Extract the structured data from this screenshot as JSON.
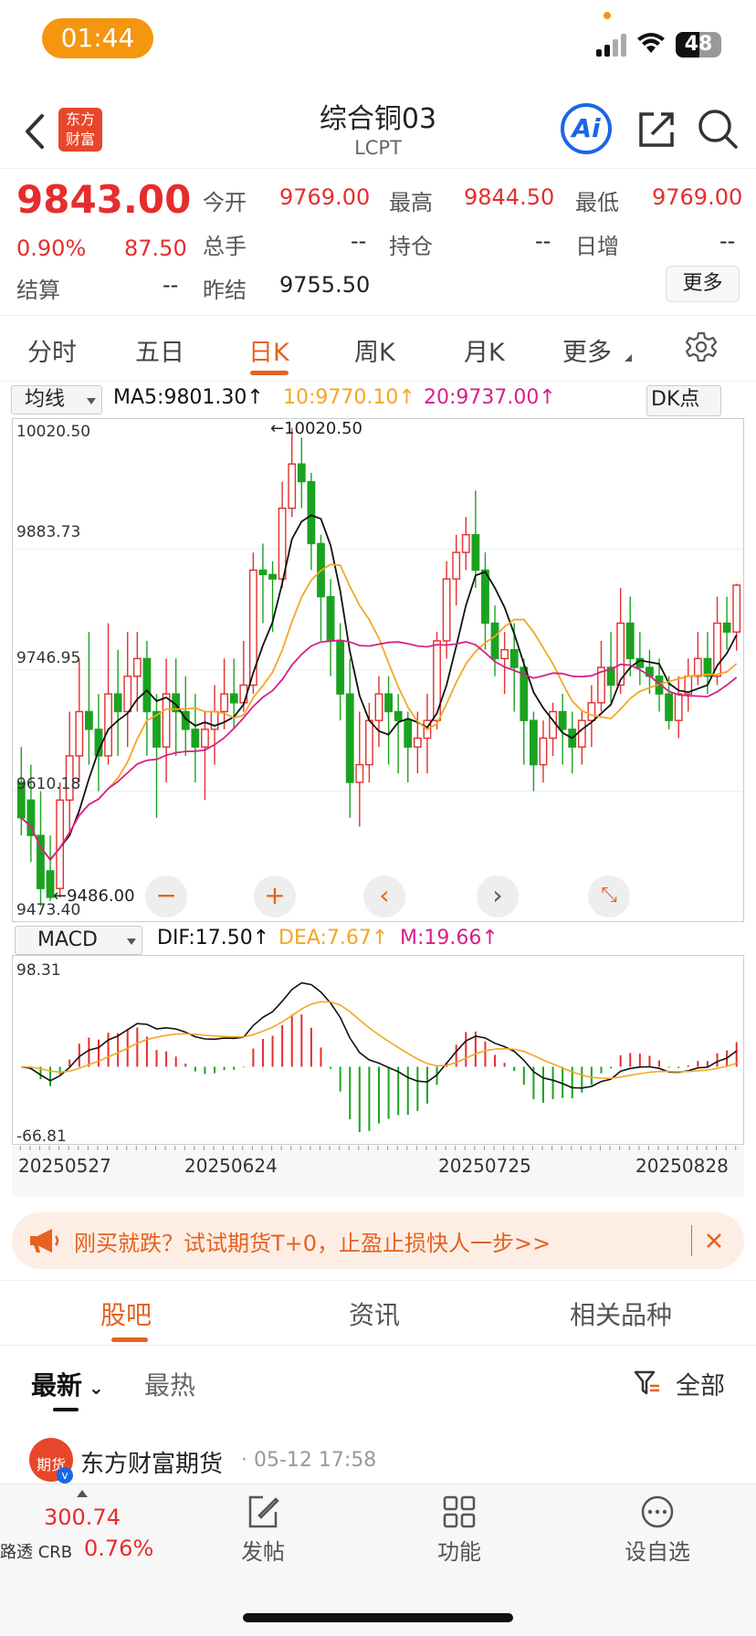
{
  "status_bar": {
    "time": "01:44",
    "battery": "48"
  },
  "header": {
    "title": "综合铜03",
    "subtitle": "LCPT",
    "logo_text_1": "东方",
    "logo_text_2": "财富",
    "ai_label": "Ai"
  },
  "quote": {
    "price": "9843.00",
    "change_pct": "0.90%",
    "change": "87.50",
    "open_label": "今开",
    "open": "9769.00",
    "high_label": "最高",
    "high": "9844.50",
    "low_label": "最低",
    "low": "9769.00",
    "volume_label": "总手",
    "volume": "--",
    "oi_label": "持仓",
    "oi": "--",
    "daily_inc_label": "日增",
    "daily_inc": "--",
    "settle_label": "结算",
    "settle": "--",
    "prev_settle_label": "昨结",
    "prev_settle": "9755.50",
    "more_label": "更多"
  },
  "tabs": [
    "分时",
    "五日",
    "日K",
    "周K",
    "月K",
    "更多"
  ],
  "active_tab_index": 2,
  "indicators": {
    "ma_select": "均线",
    "ma5": "MA5:9801.30↑",
    "ma10": "10:9770.10↑",
    "ma20": "20:9737.00↑",
    "dk": "DK点",
    "macd_select": "MACD",
    "dif": "DIF:17.50↑",
    "dea": "DEA:7.67↑",
    "m": "M:19.66↑"
  },
  "colors": {
    "up": "#e62d2d",
    "down": "#1aa320",
    "ma5": "#111111",
    "ma10": "#f5a623",
    "ma20": "#d6208a",
    "accent": "#e6621e"
  },
  "chart_data": [
    {
      "type": "candlestick",
      "title": "",
      "y_ticks": [
        "10020.50",
        "9883.73",
        "9746.95",
        "9610.18",
        "9473.40"
      ],
      "ylim": [
        9473.4,
        10020.5
      ],
      "max_label": "10020.50",
      "min_label": "9486.00",
      "x_ticks": [
        "20250527",
        "20250624",
        "20250725",
        "20250828"
      ],
      "candles": [
        [
          9620,
          9580,
          9660,
          9560
        ],
        [
          9600,
          9560,
          9640,
          9530
        ],
        [
          9560,
          9500,
          9610,
          9480
        ],
        [
          9520,
          9490,
          9560,
          9486
        ],
        [
          9500,
          9600,
          9620,
          9490
        ],
        [
          9600,
          9650,
          9700,
          9560
        ],
        [
          9650,
          9700,
          9760,
          9620
        ],
        [
          9700,
          9680,
          9790,
          9640
        ],
        [
          9680,
          9650,
          9720,
          9610
        ],
        [
          9650,
          9720,
          9800,
          9640
        ],
        [
          9720,
          9700,
          9770,
          9650
        ],
        [
          9700,
          9740,
          9790,
          9660
        ],
        [
          9740,
          9760,
          9790,
          9700
        ],
        [
          9760,
          9700,
          9780,
          9650
        ],
        [
          9700,
          9660,
          9720,
          9580
        ],
        [
          9660,
          9720,
          9760,
          9620
        ],
        [
          9720,
          9700,
          9760,
          9650
        ],
        [
          9700,
          9680,
          9740,
          9650
        ],
        [
          9680,
          9660,
          9720,
          9620
        ],
        [
          9660,
          9680,
          9700,
          9600
        ],
        [
          9680,
          9700,
          9730,
          9640
        ],
        [
          9700,
          9720,
          9760,
          9680
        ],
        [
          9720,
          9710,
          9760,
          9680
        ],
        [
          9710,
          9730,
          9780,
          9700
        ],
        [
          9730,
          9860,
          9880,
          9720
        ],
        [
          9860,
          9855,
          9890,
          9800
        ],
        [
          9855,
          9850,
          9870,
          9790
        ],
        [
          9850,
          9930,
          9960,
          9840
        ],
        [
          9930,
          9980,
          10020.5,
          9920
        ],
        [
          9980,
          9960,
          10010,
          9930
        ],
        [
          9960,
          9890,
          9970,
          9860
        ],
        [
          9890,
          9830,
          9900,
          9780
        ],
        [
          9830,
          9780,
          9850,
          9740
        ],
        [
          9780,
          9720,
          9800,
          9690
        ],
        [
          9720,
          9620,
          9760,
          9580
        ],
        [
          9620,
          9640,
          9700,
          9570
        ],
        [
          9640,
          9690,
          9710,
          9620
        ],
        [
          9690,
          9720,
          9740,
          9660
        ],
        [
          9720,
          9700,
          9740,
          9640
        ],
        [
          9700,
          9690,
          9720,
          9630
        ],
        [
          9690,
          9660,
          9700,
          9620
        ],
        [
          9660,
          9670,
          9700,
          9630
        ],
        [
          9670,
          9690,
          9720,
          9630
        ],
        [
          9690,
          9780,
          9790,
          9680
        ],
        [
          9780,
          9850,
          9870,
          9760
        ],
        [
          9850,
          9880,
          9900,
          9820
        ],
        [
          9880,
          9900,
          9920,
          9860
        ],
        [
          9900,
          9860,
          9950,
          9840
        ],
        [
          9860,
          9800,
          9880,
          9770
        ],
        [
          9800,
          9760,
          9820,
          9740
        ],
        [
          9760,
          9770,
          9790,
          9720
        ],
        [
          9770,
          9750,
          9800,
          9700
        ],
        [
          9750,
          9690,
          9760,
          9640
        ],
        [
          9690,
          9640,
          9700,
          9610
        ],
        [
          9640,
          9670,
          9690,
          9620
        ],
        [
          9670,
          9700,
          9710,
          9650
        ],
        [
          9700,
          9680,
          9720,
          9640
        ],
        [
          9680,
          9660,
          9700,
          9630
        ],
        [
          9660,
          9690,
          9700,
          9640
        ],
        [
          9690,
          9710,
          9730,
          9660
        ],
        [
          9710,
          9750,
          9780,
          9700
        ],
        [
          9750,
          9730,
          9790,
          9710
        ],
        [
          9730,
          9800,
          9840,
          9720
        ],
        [
          9800,
          9760,
          9830,
          9740
        ],
        [
          9760,
          9750,
          9790,
          9730
        ],
        [
          9750,
          9740,
          9770,
          9720
        ],
        [
          9740,
          9720,
          9760,
          9700
        ],
        [
          9720,
          9690,
          9740,
          9680
        ],
        [
          9690,
          9720,
          9740,
          9670
        ],
        [
          9720,
          9740,
          9760,
          9700
        ],
        [
          9740,
          9760,
          9790,
          9730
        ],
        [
          9760,
          9740,
          9790,
          9720
        ],
        [
          9740,
          9800,
          9830,
          9730
        ],
        [
          9800,
          9790,
          9830,
          9770
        ],
        [
          9790,
          9843,
          9844.5,
          9769
        ]
      ]
    },
    {
      "type": "macd",
      "y_ticks": [
        "98.31",
        "-66.81"
      ],
      "ylim": [
        -66.81,
        98.31
      ]
    }
  ],
  "banner": {
    "text": "刚买就跌？试试期货T+0，止盈止损快人一步>>"
  },
  "section_tabs": [
    "股吧",
    "资讯",
    "相关品种"
  ],
  "sub_tabs": {
    "latest": "最新",
    "hot": "最热",
    "filter": "全部"
  },
  "post": {
    "author": "东方财富期货",
    "time": "· 05-12 17:58",
    "avatar_text": "期货"
  },
  "bottom": {
    "index_value": "300.74",
    "index_name": "路透 CRB",
    "index_change": "0.76%",
    "nav": [
      "发帖",
      "功能",
      "设自选"
    ]
  }
}
